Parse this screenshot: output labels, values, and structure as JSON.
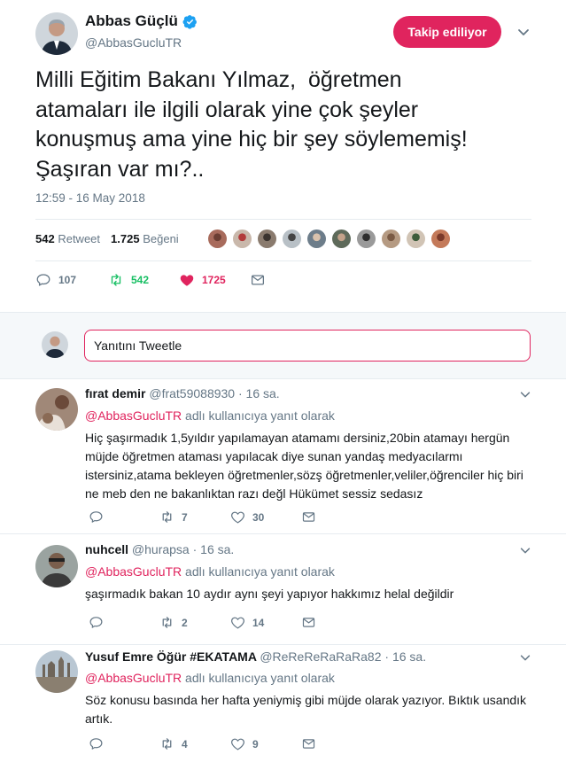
{
  "tweet": {
    "author_name": "Abbas Güçlü",
    "author_handle": "@AbbasGucluTR",
    "follow_label": "Takip ediliyor",
    "text": "Milli Eğitim Bakanı Yılmaz,  öğretmen\natamaları ile ilgili olarak yine çok şeyler\nkonuşmuş ama yine hiç bir şey söylememiş!\nŞaşıran var mı?..",
    "timestamp": "12:59 - 16 May 2018",
    "retweet_count": "542",
    "retweet_label": "Retweet",
    "like_count": "1.725",
    "like_label": "Beğeni",
    "actions": {
      "replies": "107",
      "retweets": "542",
      "likes": "1725"
    }
  },
  "reply_composer": {
    "placeholder": "Yanıtını Tweetle"
  },
  "replies": [
    {
      "name": "fırat demir",
      "handle": "@frat59088930",
      "time": "16 sa.",
      "reply_to_mention": "@AbbasGucluTR",
      "reply_to_suffix": "adlı kullanıcıya yanıt olarak",
      "text": "Hiç şaşırmadık 1,5yıldır yapılamayan atamamı dersiniz,20bin atamayı hergün müjde öğretmen ataması yapılacak diye sunan yandaş medyacılarmı istersiniz,atama bekleyen öğretmenler,sözş öğretmenler,veliler,öğrenciler hiç biri ne meb den ne bakanlıktan razı değl Hükümet sessiz sedasız",
      "retweets": "7",
      "likes": "30"
    },
    {
      "name": "nuhcell",
      "handle": "@hurapsa",
      "time": "16 sa.",
      "reply_to_mention": "@AbbasGucluTR",
      "reply_to_suffix": "adlı kullanıcıya yanıt olarak",
      "text": "şaşırmadık bakan 10 aydır aynı şeyi yapıyor hakkımız helal değildir",
      "retweets": "2",
      "likes": "14"
    },
    {
      "name": "Yusuf Emre Öğür #EKATAMA",
      "handle": "@ReReReRaRaRa82",
      "time": "16 sa.",
      "reply_to_mention": "@AbbasGucluTR",
      "reply_to_suffix": "adlı kullanıcıya yanıt olarak",
      "text": "Söz konusu basında her hafta yeniymiş gibi müjde olarak yazıyor. Bıktık usandık artık.",
      "retweets": "4",
      "likes": "9"
    }
  ],
  "colors": {
    "accent": "#e0245e",
    "retweet_green": "#17bf63",
    "muted": "#657786",
    "verified": "#1da1f2"
  },
  "icons": [
    "verified-badge-icon",
    "chevron-down-icon",
    "reply-icon",
    "retweet-icon",
    "heart-icon",
    "envelope-icon"
  ]
}
